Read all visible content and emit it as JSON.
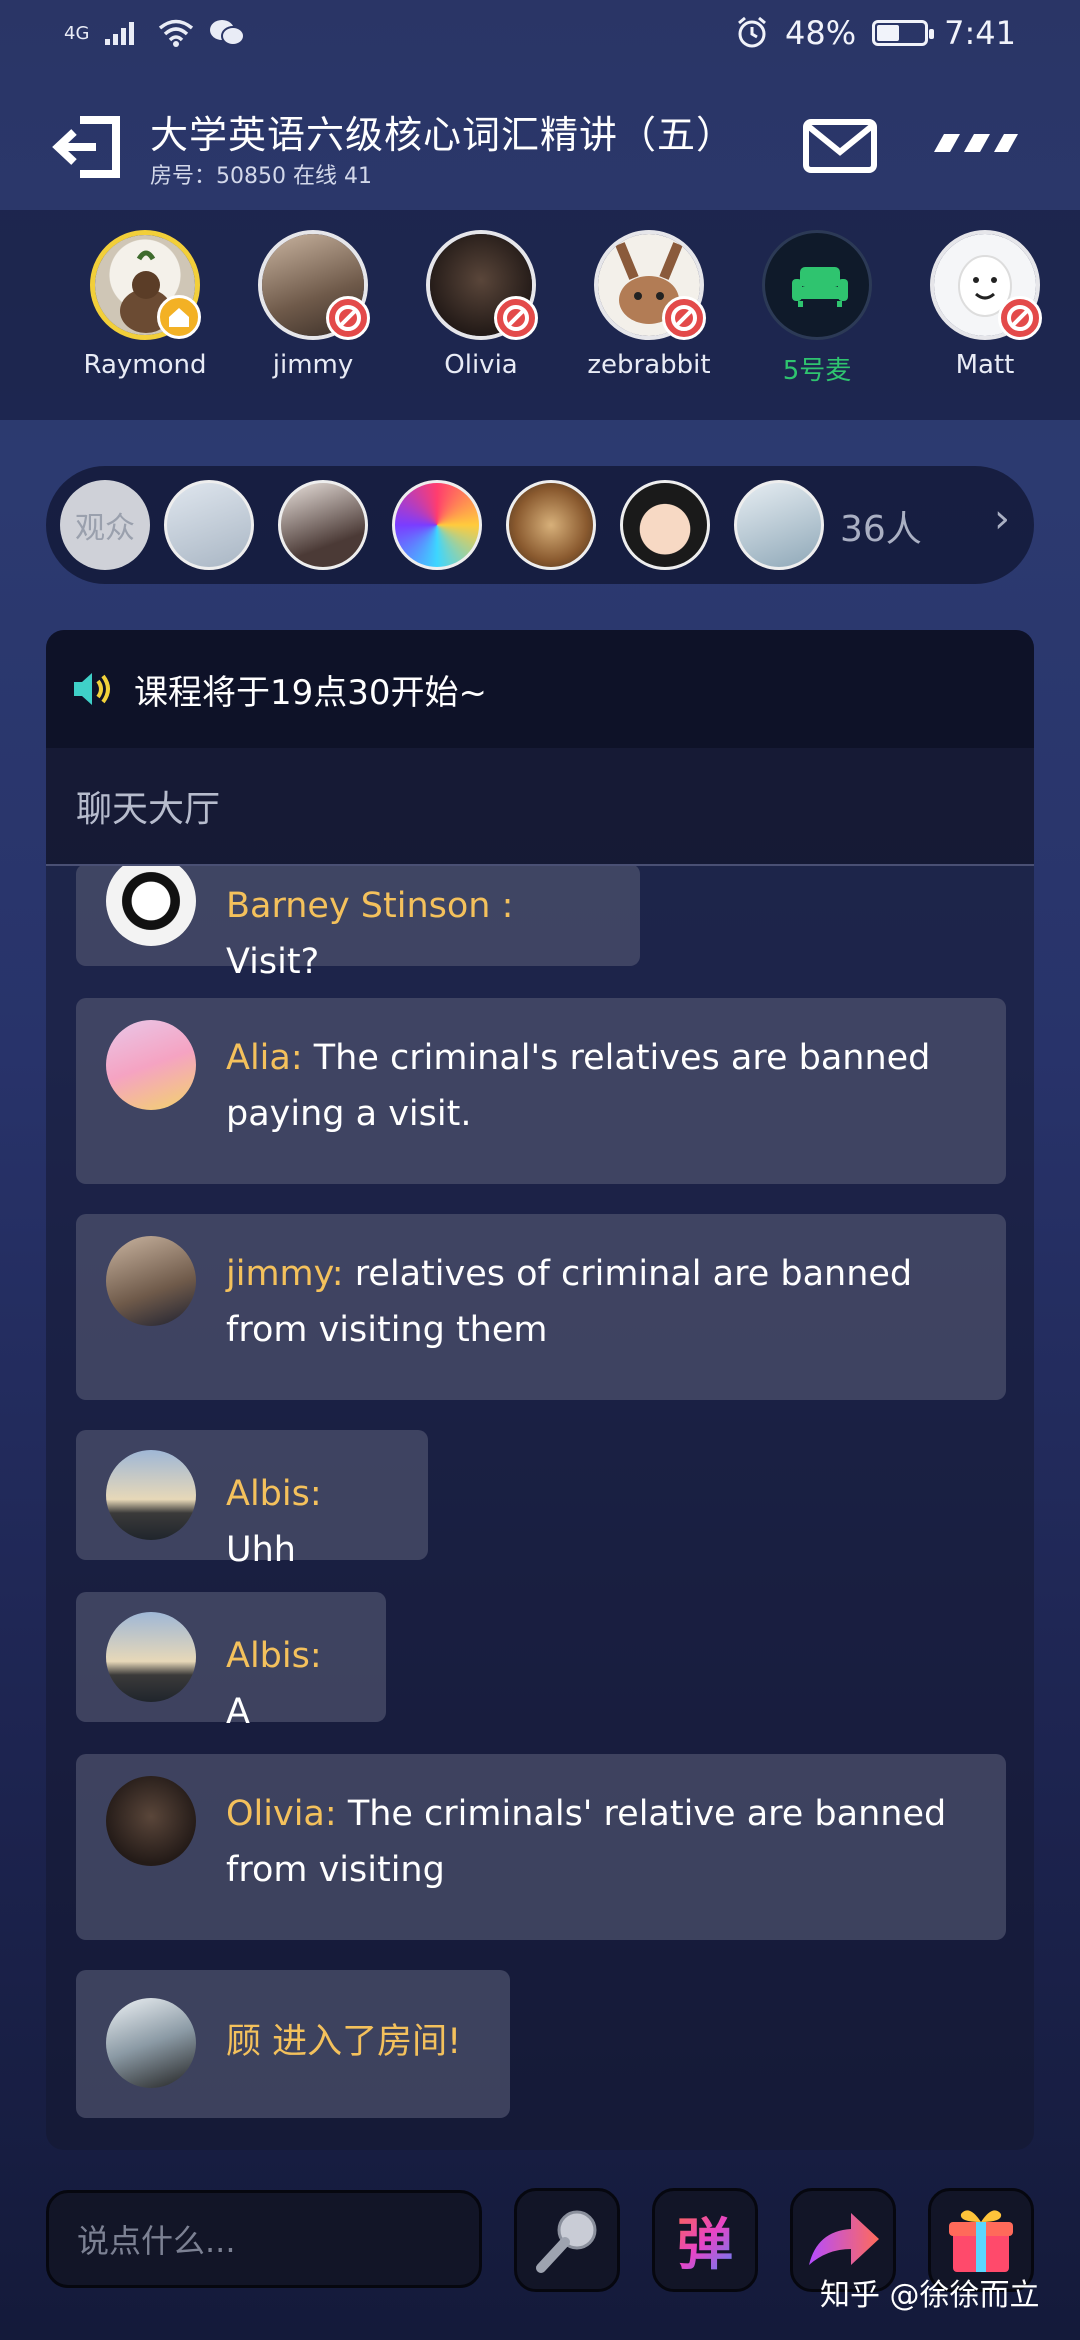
{
  "status": {
    "network": "4G",
    "battery_text": "48%",
    "battery_level": 0.48,
    "time": "7:41"
  },
  "header": {
    "title": "大学英语六级核心词汇精讲（五）",
    "subtitle": "房号：50850 在线 41"
  },
  "mic_seats": [
    {
      "name": "Raymond"
    },
    {
      "name": "jimmy"
    },
    {
      "name": "Olivia"
    },
    {
      "name": "zebrabbit"
    },
    {
      "name": "5号麦"
    },
    {
      "name": "Matt"
    }
  ],
  "audience": {
    "label": "观众",
    "count": "36人"
  },
  "notice": {
    "text": "课程将于19点30开始~"
  },
  "chat_hall_label": "聊天大厅",
  "messages": [
    {
      "user": "Barney Stinson :",
      "text": " Visit?"
    },
    {
      "user": "Alia:",
      "text": " The criminal's relatives are banned paying a visit."
    },
    {
      "user": "jimmy:",
      "text": " relatives of criminal are banned from visiting them"
    },
    {
      "user": "Albis:",
      "text": " Uhh"
    },
    {
      "user": "Albis:",
      "text": " A"
    },
    {
      "user": "Olivia:",
      "text": " The  criminals' relative  are  banned from visiting"
    },
    {
      "user": "",
      "text": "顾 进入了房间!"
    }
  ],
  "input": {
    "placeholder": "说点什么..."
  },
  "toolbar": {
    "danmu_label": "弹"
  },
  "watermark": "知乎 @徐徐而立",
  "colors": {
    "accent_username": "#f4c15c",
    "mic_free_green": "#2fc46f",
    "badge_red": "#e34a4a"
  }
}
